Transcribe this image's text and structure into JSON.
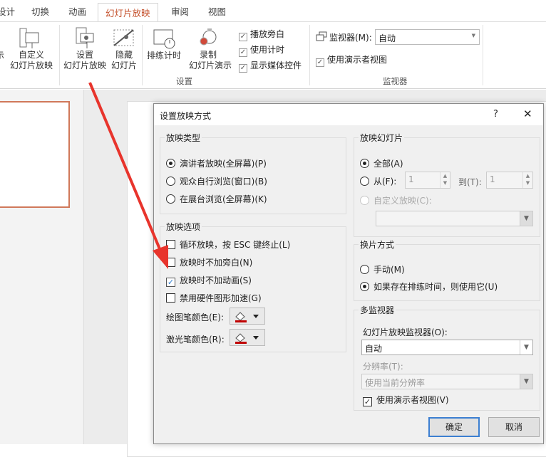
{
  "tabs": [
    "设计",
    "切换",
    "动画",
    "幻灯片放映",
    "审阅",
    "视图"
  ],
  "active_tab": "幻灯片放映",
  "ribbon": {
    "custom_show": [
      "自定义",
      "幻灯片放映"
    ],
    "setup_show": [
      "设置",
      "幻灯片放映"
    ],
    "hide_slide": [
      "隐藏",
      "幻灯片"
    ],
    "rehearse": "排练计时",
    "record": [
      "录制",
      "幻灯片演示"
    ],
    "checks": [
      {
        "label": "播放旁白",
        "checked": true
      },
      {
        "label": "使用计时",
        "checked": true
      },
      {
        "label": "显示媒体控件",
        "checked": true
      }
    ],
    "setup_group": "设置",
    "monitor_label": "监视器(M):",
    "monitor_value": "自动",
    "presenter_view": "使用演示者视图",
    "monitor_group": "监视器",
    "left_cut": "示"
  },
  "dialog": {
    "title": "设置放映方式",
    "help": "?",
    "close": "✕",
    "show_type": {
      "legend": "放映类型",
      "options": [
        "演讲者放映(全屏幕)(P)",
        "观众自行浏览(窗口)(B)",
        "在展台浏览(全屏幕)(K)"
      ],
      "selected": 0
    },
    "show_options": {
      "legend": "放映选项",
      "items": [
        {
          "label": "循环放映，按 ESC 键终止(L)",
          "checked": false
        },
        {
          "label": "放映时不加旁白(N)",
          "checked": false
        },
        {
          "label": "放映时不加动画(S)",
          "checked": true
        },
        {
          "label": "禁用硬件图形加速(G)",
          "checked": false
        }
      ],
      "pen_color": "绘图笔颜色(E):",
      "laser_color": "激光笔颜色(R):"
    },
    "slides": {
      "legend": "放映幻灯片",
      "all": "全部(A)",
      "from": "从(F):",
      "from_value": "1",
      "to": "到(T):",
      "to_value": "1",
      "custom": "自定义放映(C):"
    },
    "advance": {
      "legend": "换片方式",
      "manual": "手动(M)",
      "timings": "如果存在排练时间，则使用它(U)",
      "selected": 1
    },
    "monitors": {
      "legend": "多监视器",
      "monitor_label": "幻灯片放映监视器(O):",
      "monitor_value": "自动",
      "resolution_label": "分辨率(T):",
      "resolution_value": "使用当前分辨率",
      "presenter_view": "使用演示者视图(V)",
      "presenter_checked": true
    },
    "ok": "确定",
    "cancel": "取消"
  },
  "colors": {
    "accent": "#c4502b",
    "arrow": "#e8342c",
    "pen": "#c00000"
  }
}
